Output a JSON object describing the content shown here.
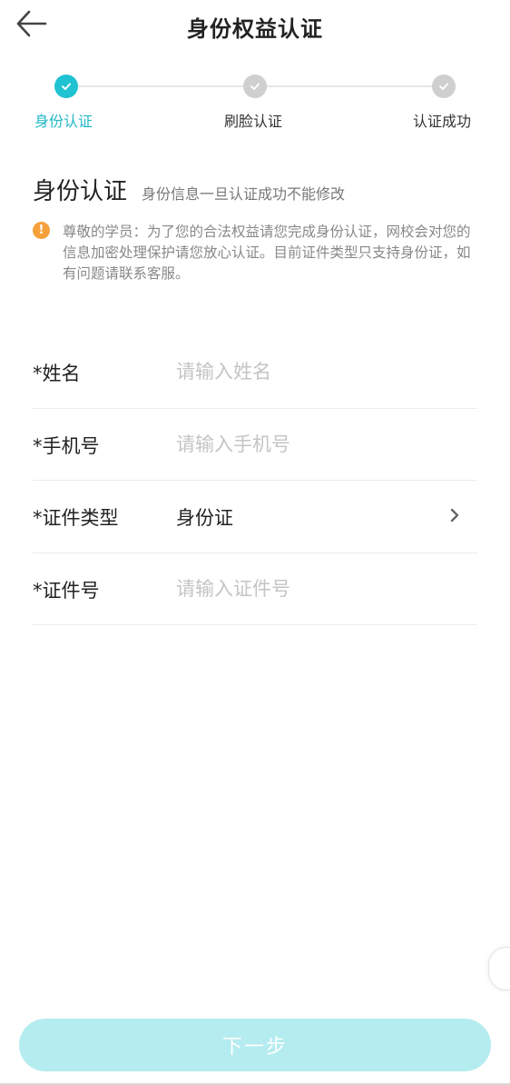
{
  "header": {
    "title": "身份权益认证",
    "back_icon": "arrow-left-icon"
  },
  "steps": [
    {
      "label": "身份认证",
      "state": "active",
      "icon": "check-icon"
    },
    {
      "label": "刷脸认证",
      "state": "pending",
      "icon": "check-icon"
    },
    {
      "label": "认证成功",
      "state": "pending",
      "icon": "check-icon"
    }
  ],
  "section": {
    "title": "身份认证",
    "subtitle": "身份信息一旦认证成功不能修改"
  },
  "notice": {
    "icon": "warning-icon",
    "icon_glyph": "!",
    "text": "尊敬的学员：为了您的合法权益请您完成身份认证，网校会对您的信息加密处理保护请您放心认证。目前证件类型只支持身份证，如有问题请联系客服。"
  },
  "form": {
    "name": {
      "label": "*姓名",
      "placeholder": "请输入姓名",
      "value": ""
    },
    "phone": {
      "label": "*手机号",
      "placeholder": "请输入手机号",
      "value": ""
    },
    "id_type": {
      "label": "*证件类型",
      "value": "身份证",
      "icon": "chevron-right-icon"
    },
    "id_number": {
      "label": "*证件号",
      "placeholder": "请输入证件号",
      "value": ""
    }
  },
  "next_button": {
    "label": "下一步"
  },
  "colors": {
    "accent": "#1fc3d1",
    "inactive_step": "#cfcfcf",
    "warning": "#f6a03c",
    "button_disabled": "#b4ecef"
  }
}
